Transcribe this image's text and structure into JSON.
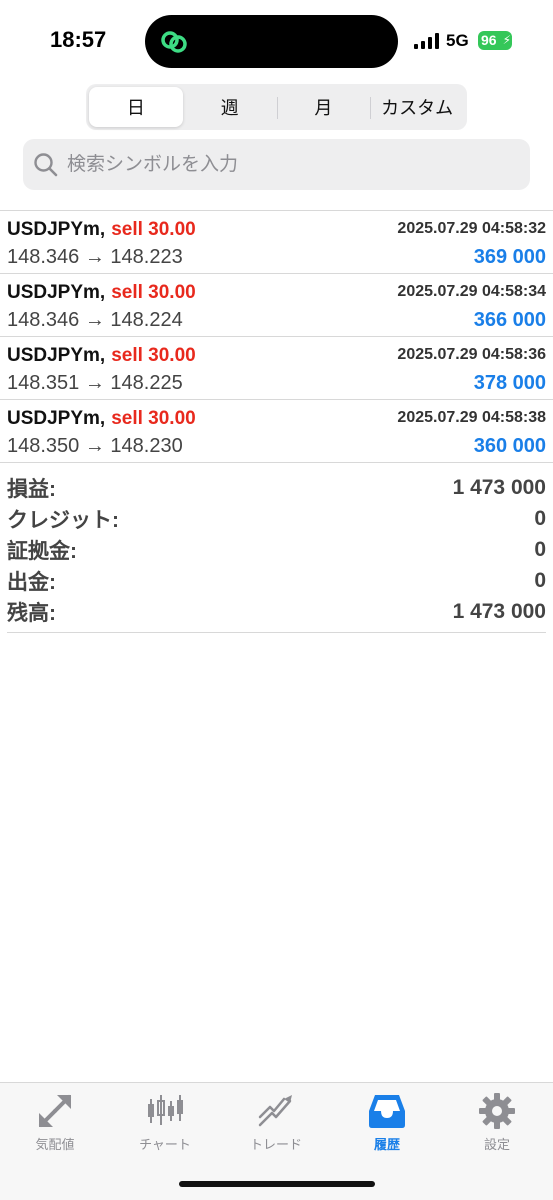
{
  "status_bar": {
    "time": "18:57",
    "network": "5G",
    "battery": "96",
    "island_icon": "link-circles-icon"
  },
  "segments": [
    {
      "label": "日",
      "active": true
    },
    {
      "label": "週",
      "active": false
    },
    {
      "label": "月",
      "active": false
    },
    {
      "label": "カスタム",
      "active": false
    }
  ],
  "search": {
    "placeholder": "検索シンボルを入力",
    "icon": "search-icon"
  },
  "trades": [
    {
      "symbol": "USDJPYm,",
      "side": "sell 30.00",
      "time": "2025.07.29 04:58:32",
      "prices": "148.346 → 148.223",
      "profit": "369 000"
    },
    {
      "symbol": "USDJPYm,",
      "side": "sell 30.00",
      "time": "2025.07.29 04:58:34",
      "prices": "148.346 → 148.224",
      "profit": "366 000"
    },
    {
      "symbol": "USDJPYm,",
      "side": "sell 30.00",
      "time": "2025.07.29 04:58:36",
      "prices": "148.351 → 148.225",
      "profit": "378 000"
    },
    {
      "symbol": "USDJPYm,",
      "side": "sell 30.00",
      "time": "2025.07.29 04:58:38",
      "prices": "148.350 → 148.230",
      "profit": "360 000"
    }
  ],
  "summary": [
    {
      "label": "損益:",
      "value": "1 473 000"
    },
    {
      "label": "クレジット:",
      "value": "0"
    },
    {
      "label": "証拠金:",
      "value": "0"
    },
    {
      "label": "出金:",
      "value": "0"
    },
    {
      "label": "残高:",
      "value": "1 473 000"
    }
  ],
  "tab_bar": [
    {
      "label": "気配値",
      "icon": "quotes-arrows-icon",
      "active": false
    },
    {
      "label": "チャート",
      "icon": "candlestick-icon",
      "active": false
    },
    {
      "label": "トレード",
      "icon": "trade-chart-icon",
      "active": false
    },
    {
      "label": "履歴",
      "icon": "history-inbox-icon",
      "active": true
    },
    {
      "label": "設定",
      "icon": "gear-icon",
      "active": false
    }
  ],
  "colors": {
    "sell": "#e8291d",
    "profit": "#1a7fe8",
    "active_tab": "#1a7fe8",
    "battery": "#34c759"
  }
}
